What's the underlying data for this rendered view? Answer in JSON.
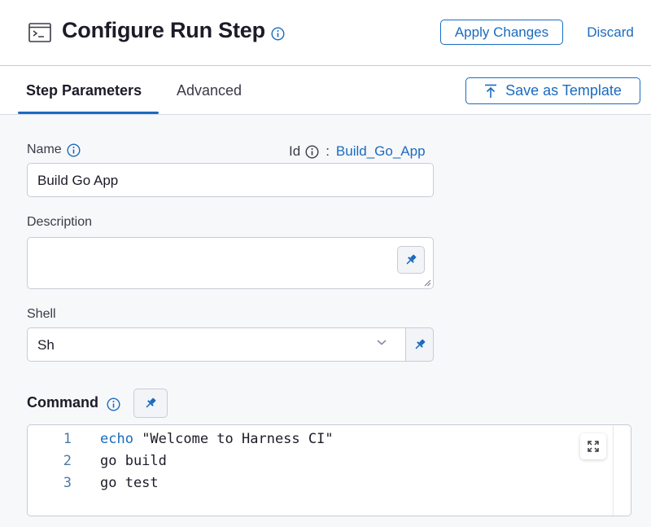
{
  "header": {
    "title": "Configure Run Step",
    "apply_label": "Apply Changes",
    "discard_label": "Discard"
  },
  "tabs": [
    {
      "label": "Step Parameters",
      "active": true
    },
    {
      "label": "Advanced",
      "active": false
    }
  ],
  "save_template_label": "Save as Template",
  "form": {
    "name": {
      "label": "Name",
      "value": "Build Go App"
    },
    "id": {
      "label": "Id",
      "separator": ":",
      "value": "Build_Go_App"
    },
    "description": {
      "label": "Description",
      "value": ""
    },
    "shell": {
      "label": "Shell",
      "value": "Sh"
    },
    "command": {
      "label": "Command",
      "lines": [
        {
          "number": "1",
          "keyword": "echo",
          "rest": " \"Welcome to Harness CI\""
        },
        {
          "number": "2",
          "keyword": "",
          "rest": "go build"
        },
        {
          "number": "3",
          "keyword": "",
          "rest": "go test"
        }
      ]
    }
  },
  "colors": {
    "accent": "#1a6bbf",
    "background": "#f7f8fa",
    "border": "#c9cbd6"
  }
}
